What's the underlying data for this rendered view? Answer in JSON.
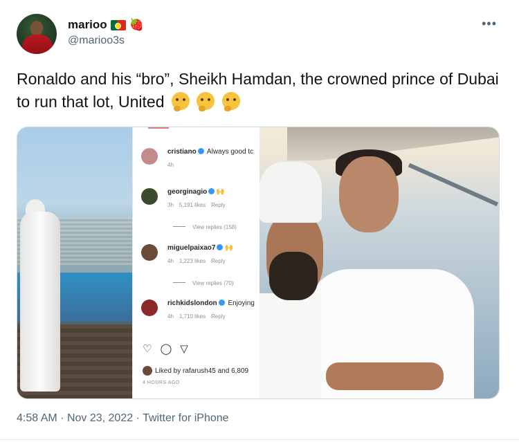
{
  "user": {
    "name": "marioo",
    "handle": "@marioo3s",
    "badges": [
      "portugal-flag",
      "strawberry"
    ]
  },
  "more_label": "•••",
  "tweet": {
    "text": "Ronaldo and his “bro”, Sheikh Hamdan, the crowned prince of Dubai to run that lot, United",
    "emojis": [
      "thinking-face",
      "thinking-face",
      "thinking-face"
    ]
  },
  "instagram": {
    "comments": [
      {
        "user": "cristiano",
        "text": "Always good tc",
        "time": "4h",
        "likes": "",
        "reply": "",
        "avatar_color": "#c48b8b"
      },
      {
        "user": "georginagio",
        "text": "",
        "time": "3h",
        "likes": "5,191 likes",
        "reply": "Reply",
        "view_replies": "View replies (158)",
        "avatar_color": "#3d4b2c"
      },
      {
        "user": "miguelpaixao7",
        "text": "",
        "time": "4h",
        "likes": "1,223 likes",
        "reply": "Reply",
        "view_replies": "View replies (70)",
        "avatar_color": "#6b4a3a"
      },
      {
        "user": "richkidslondon",
        "text": "Enjoying",
        "time": "4h",
        "likes": "1,710 likes",
        "reply": "Reply",
        "avatar_color": "#8a2a2a"
      }
    ],
    "liked_by": "Liked by rafarush45 and 6,809",
    "timestamp": "4 HOURS AGO"
  },
  "footer": {
    "time": "4:58 AM",
    "date": "Nov 23, 2022",
    "source": "Twitter for iPhone",
    "separator": "·"
  },
  "colors": {
    "text": "#0f1419",
    "secondary": "#536471",
    "verified": "#3897f0"
  }
}
